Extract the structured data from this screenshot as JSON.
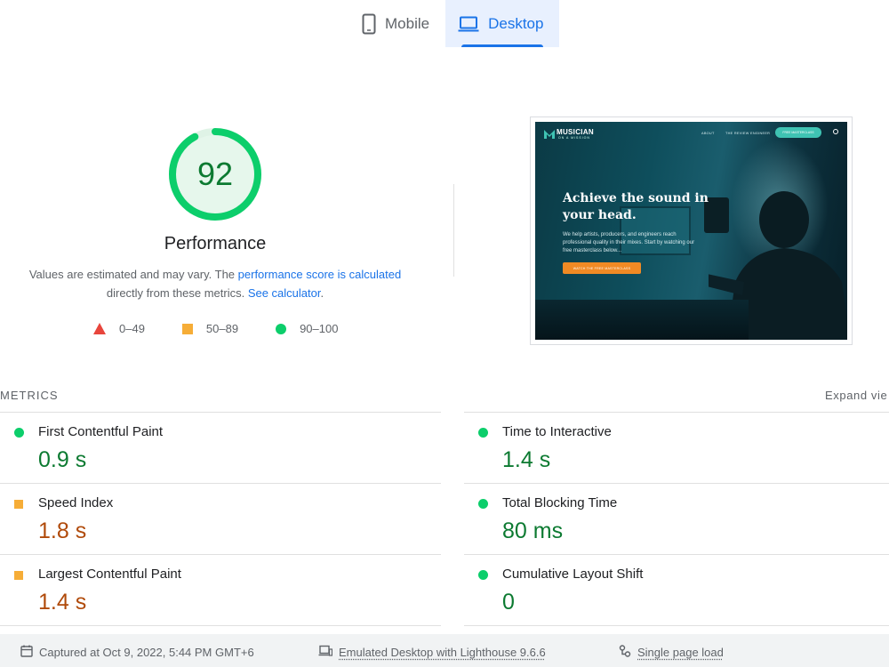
{
  "tabs": [
    {
      "label": "Mobile",
      "icon": "phone-icon",
      "active": false
    },
    {
      "label": "Desktop",
      "icon": "laptop-icon",
      "active": true
    }
  ],
  "score": {
    "value": "92",
    "fraction": 0.92,
    "title": "Performance",
    "color": "#0cce6b",
    "desc_prefix": "Values are estimated and may vary. The ",
    "desc_link1": "performance score is calculated",
    "desc_middle": " directly from these metrics. ",
    "desc_link2": "See calculator",
    "desc_suffix": "."
  },
  "legend": [
    {
      "range": "0–49",
      "shape": "triangle",
      "color": "#e8453c"
    },
    {
      "range": "50–89",
      "shape": "square",
      "color": "#f6ad37"
    },
    {
      "range": "90–100",
      "shape": "circle",
      "color": "#0cce6b"
    }
  ],
  "preview": {
    "logo": "MUSICIAN",
    "logo_sub": "ON A MISSION",
    "nav_links": [
      "ABOUT",
      "THE REVIEW ENGINEER"
    ],
    "nav_button": "FREE MASTERCLASS",
    "headline": "Achieve the sound in your head.",
    "subtext": "We help artists, producers, and engineers reach professional quality in their mixes. Start by watching our free masterclass below...",
    "cta": "WATCH THE FREE MASTERCLASS"
  },
  "metrics": {
    "title": "METRICS",
    "expand": "Expand vie",
    "items": [
      {
        "label": "First Contentful Paint",
        "value": "0.9 s",
        "status": "good"
      },
      {
        "label": "Time to Interactive",
        "value": "1.4 s",
        "status": "good"
      },
      {
        "label": "Speed Index",
        "value": "1.8 s",
        "status": "average"
      },
      {
        "label": "Total Blocking Time",
        "value": "80 ms",
        "status": "good"
      },
      {
        "label": "Largest Contentful Paint",
        "value": "1.4 s",
        "status": "average"
      },
      {
        "label": "Cumulative Layout Shift",
        "value": "0",
        "status": "good"
      }
    ]
  },
  "footer": {
    "captured": "Captured at Oct 9, 2022, 5:44 PM GMT+6",
    "emulated": "Emulated Desktop with Lighthouse 9.6.6",
    "load": "Single page load"
  },
  "colors": {
    "accent": "#1a73e8",
    "good": "#0c7a31",
    "average": "#b04a0a"
  }
}
